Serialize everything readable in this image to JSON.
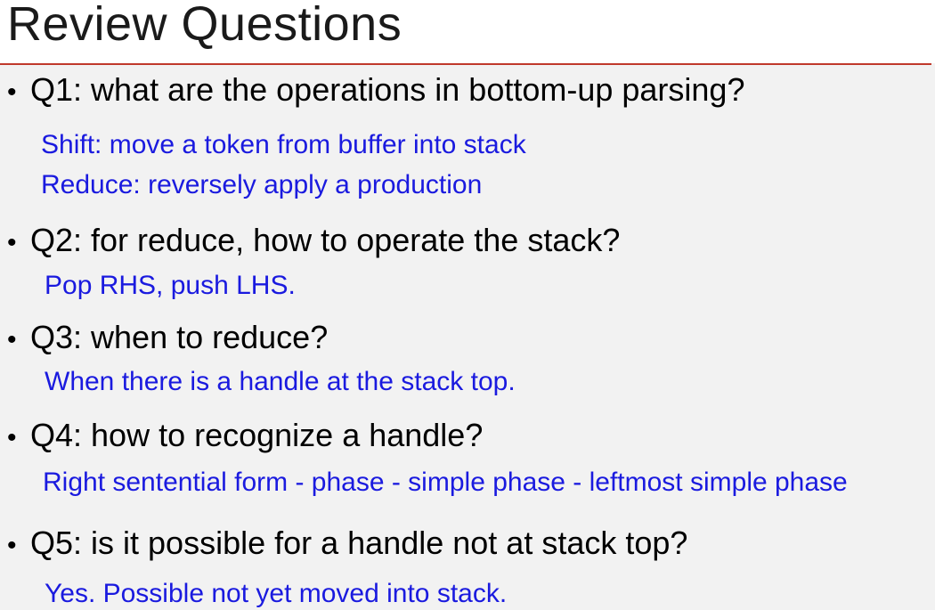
{
  "slide": {
    "title": "Review Questions",
    "bullet": "•",
    "questions": [
      {
        "question": "Q1: what are the operations in bottom-up parsing?",
        "answers": [
          "Shift: move a token from buffer into stack",
          "Reduce: reversely apply a production"
        ]
      },
      {
        "question": "Q2: for reduce, how to operate the stack?",
        "answers": [
          "Pop RHS, push LHS."
        ]
      },
      {
        "question": "Q3: when to reduce?",
        "answers": [
          "When there is a handle at the stack top."
        ]
      },
      {
        "question": "Q4: how to recognize a handle?",
        "answers": [
          "Right sentential form - phase - simple phase - leftmost simple phase"
        ]
      },
      {
        "question": "Q5: is it possible for a handle not at stack top?",
        "answers": [
          "Yes. Possible not yet moved into stack."
        ]
      }
    ]
  },
  "colors": {
    "question_text": "#000000",
    "answer_text": "#1a1adf",
    "title_rule": "#c0392b",
    "content_background": "#f2f2f2"
  }
}
